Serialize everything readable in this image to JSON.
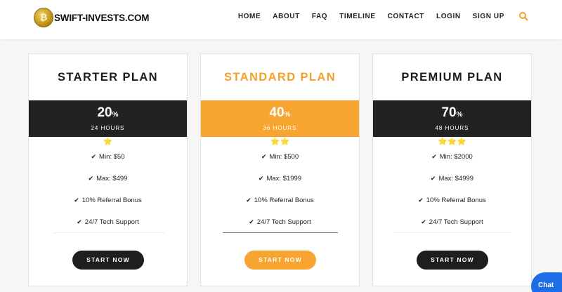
{
  "header": {
    "logo_text": "SWIFT-INVESTS.COM",
    "logo_icon": "gold-coin-icon",
    "nav": [
      "HOME",
      "ABOUT",
      "FAQ",
      "TIMELINE",
      "CONTACT",
      "LOGIN",
      "SIGN UP"
    ],
    "search_icon": "search-icon",
    "accent_color": "#f5a02a"
  },
  "plans": [
    {
      "title": "STARTER PLAN",
      "rate": "20",
      "rate_unit": "%",
      "duration": "24 HOURS",
      "stars": "⭐",
      "features": [
        "Min: $50",
        "Max: $499",
        "10% Referral Bonus",
        "24/7 Tech Support"
      ],
      "button": "START NOW",
      "band_color": "#222222"
    },
    {
      "title": "STANDARD PLAN",
      "rate": "40",
      "rate_unit": "%",
      "duration": "36 HOURS",
      "stars": "⭐⭐",
      "features": [
        "Min: $500",
        "Max: $1999",
        "10% Referral Bonus",
        "24/7 Tech Support"
      ],
      "button": "START NOW",
      "band_color": "#f7a530"
    },
    {
      "title": "PREMIUM PLAN",
      "rate": "70",
      "rate_unit": "%",
      "duration": "48 HOURS",
      "stars": "⭐⭐⭐",
      "features": [
        "Min: $2000",
        "Max: $4999",
        "10% Referral Bonus",
        "24/7 Tech Support"
      ],
      "button": "START NOW",
      "band_color": "#222222"
    }
  ],
  "chat": {
    "label": "Chat",
    "color": "#1e6ee8"
  }
}
